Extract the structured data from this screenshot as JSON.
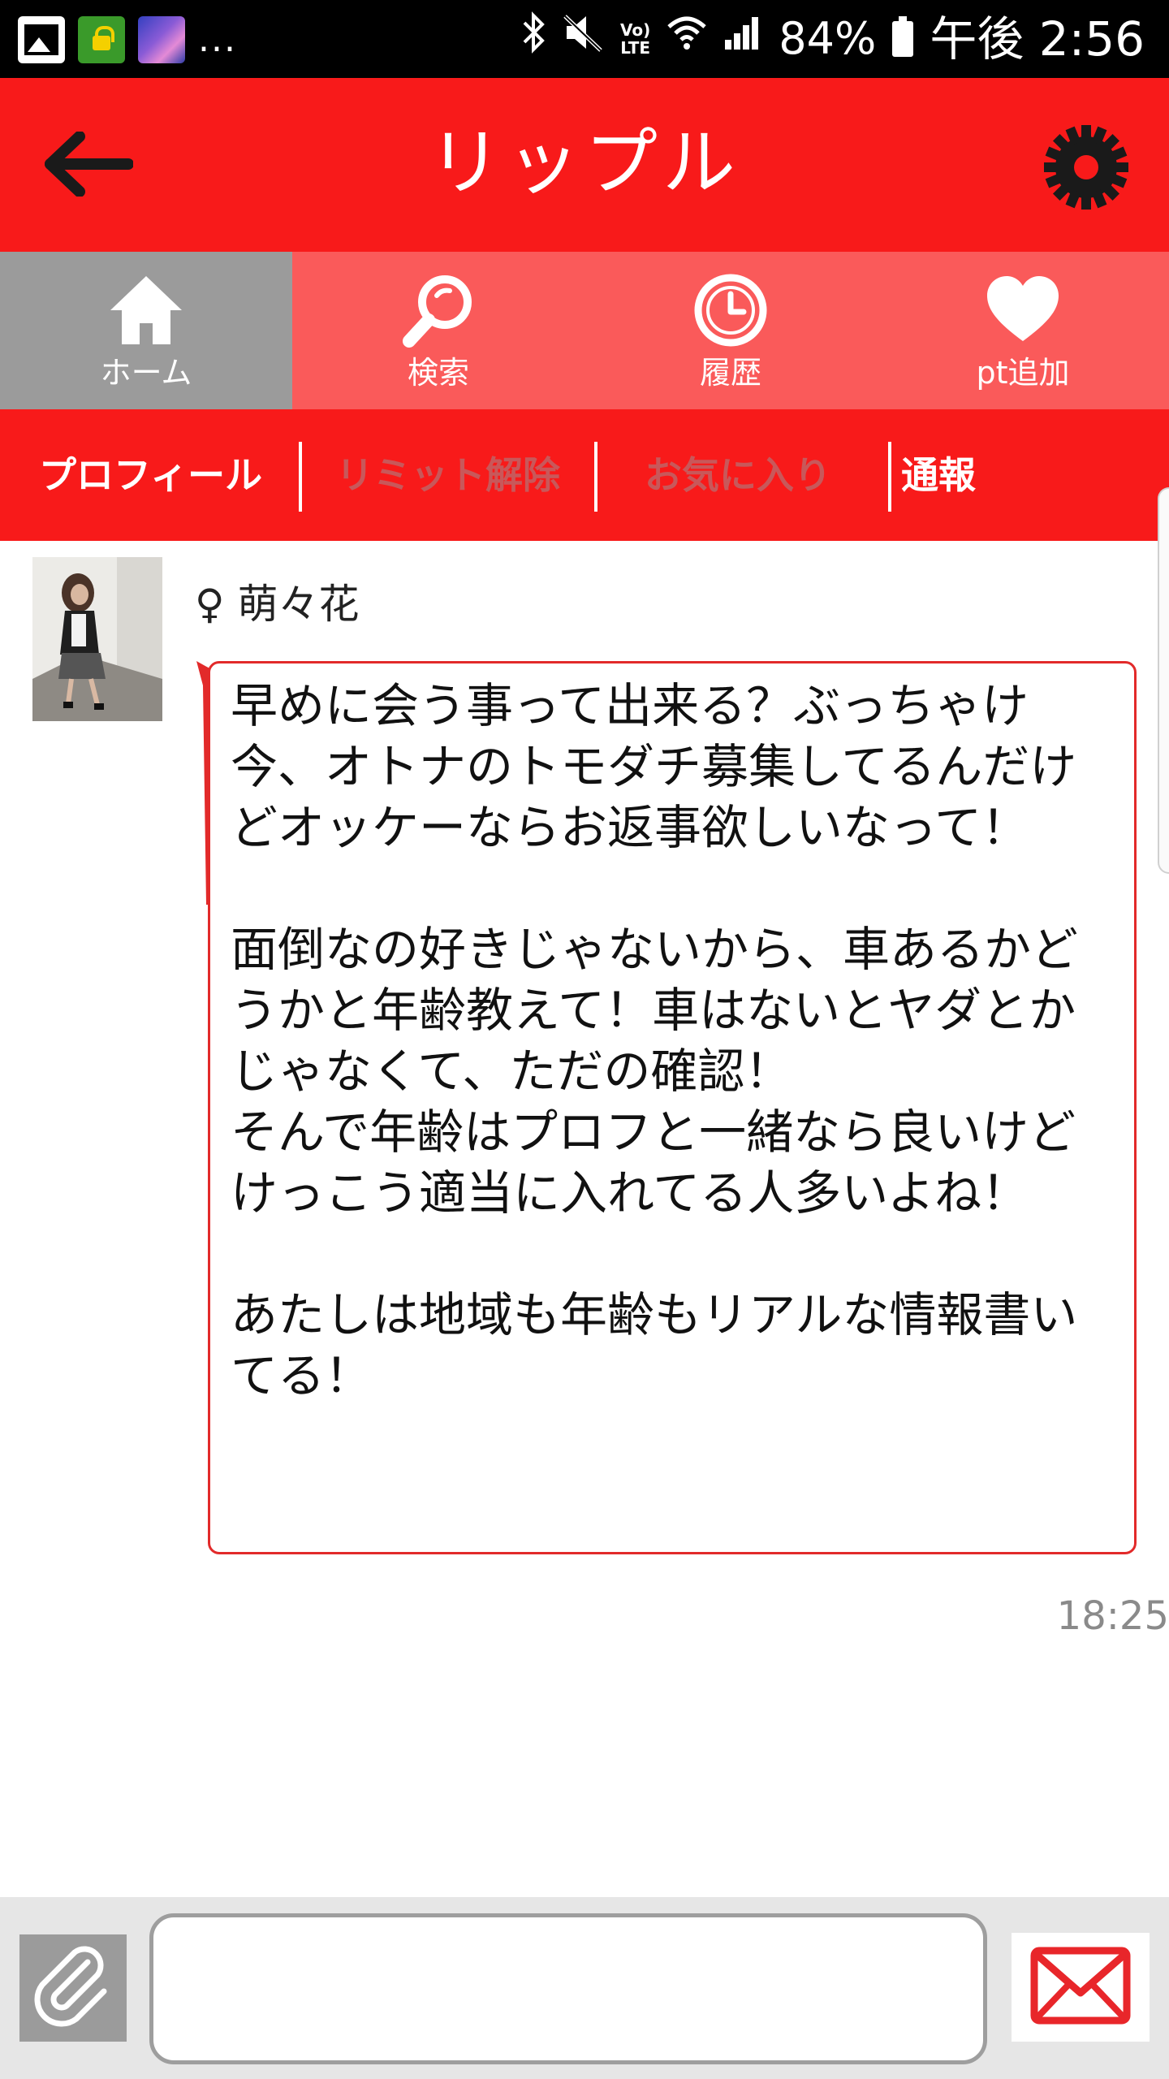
{
  "status_bar": {
    "battery_percent": "84%",
    "time": "午後 2:56",
    "more_indicator": "...",
    "network_label_1": "Vo)",
    "network_label_2": "LTE",
    "icons": [
      "gallery-icon",
      "lock-app-icon",
      "wallpaper-thumb-icon",
      "bluetooth-icon",
      "mute-icon",
      "wifi-icon",
      "signal-icon",
      "battery-icon"
    ]
  },
  "header": {
    "title": "リップル",
    "back_icon": "arrow-left-icon",
    "settings_icon": "gear-icon"
  },
  "nav_tabs": [
    {
      "label": "ホーム",
      "icon": "home-icon",
      "active": true
    },
    {
      "label": "検索",
      "icon": "search-icon",
      "active": false
    },
    {
      "label": "履歴",
      "icon": "clock-icon",
      "active": false
    },
    {
      "label": "pt追加",
      "icon": "heart-icon",
      "active": false
    }
  ],
  "sub_tabs": [
    {
      "label": "プロフィール",
      "enabled": true
    },
    {
      "label": "リミット解除",
      "enabled": false
    },
    {
      "label": "お気に入り",
      "enabled": false
    },
    {
      "label": "通報",
      "enabled": true
    }
  ],
  "message": {
    "gender_symbol": "♀",
    "sender_name": "萌々花",
    "body": "早めに会う事って出来る？ぶっちゃけ今、オトナのトモダチ募集してるんだけどオッケーならお返事欲しいなって！\n\n面倒なの好きじゃないから、車あるかどうかと年齢教えて！車はないとヤダとかじゃなくて、ただの確認！\nそんで年齢はプロフと一緒なら良いけどけっこう適当に入れてる人多いよね！\n\nあたしは地域も年齢もリアルな情報書いてる！",
    "time": "18:25"
  },
  "composer": {
    "attach_icon": "paperclip-icon",
    "send_icon": "envelope-icon",
    "value": "",
    "placeholder": ""
  },
  "colors": {
    "primary_red": "#f81a1a",
    "tab_red": "#fa5a5a",
    "tab_active_gray": "#9b9b9b",
    "disabled_tab_text": "#c8585a",
    "bubble_border": "#e22a2a"
  }
}
